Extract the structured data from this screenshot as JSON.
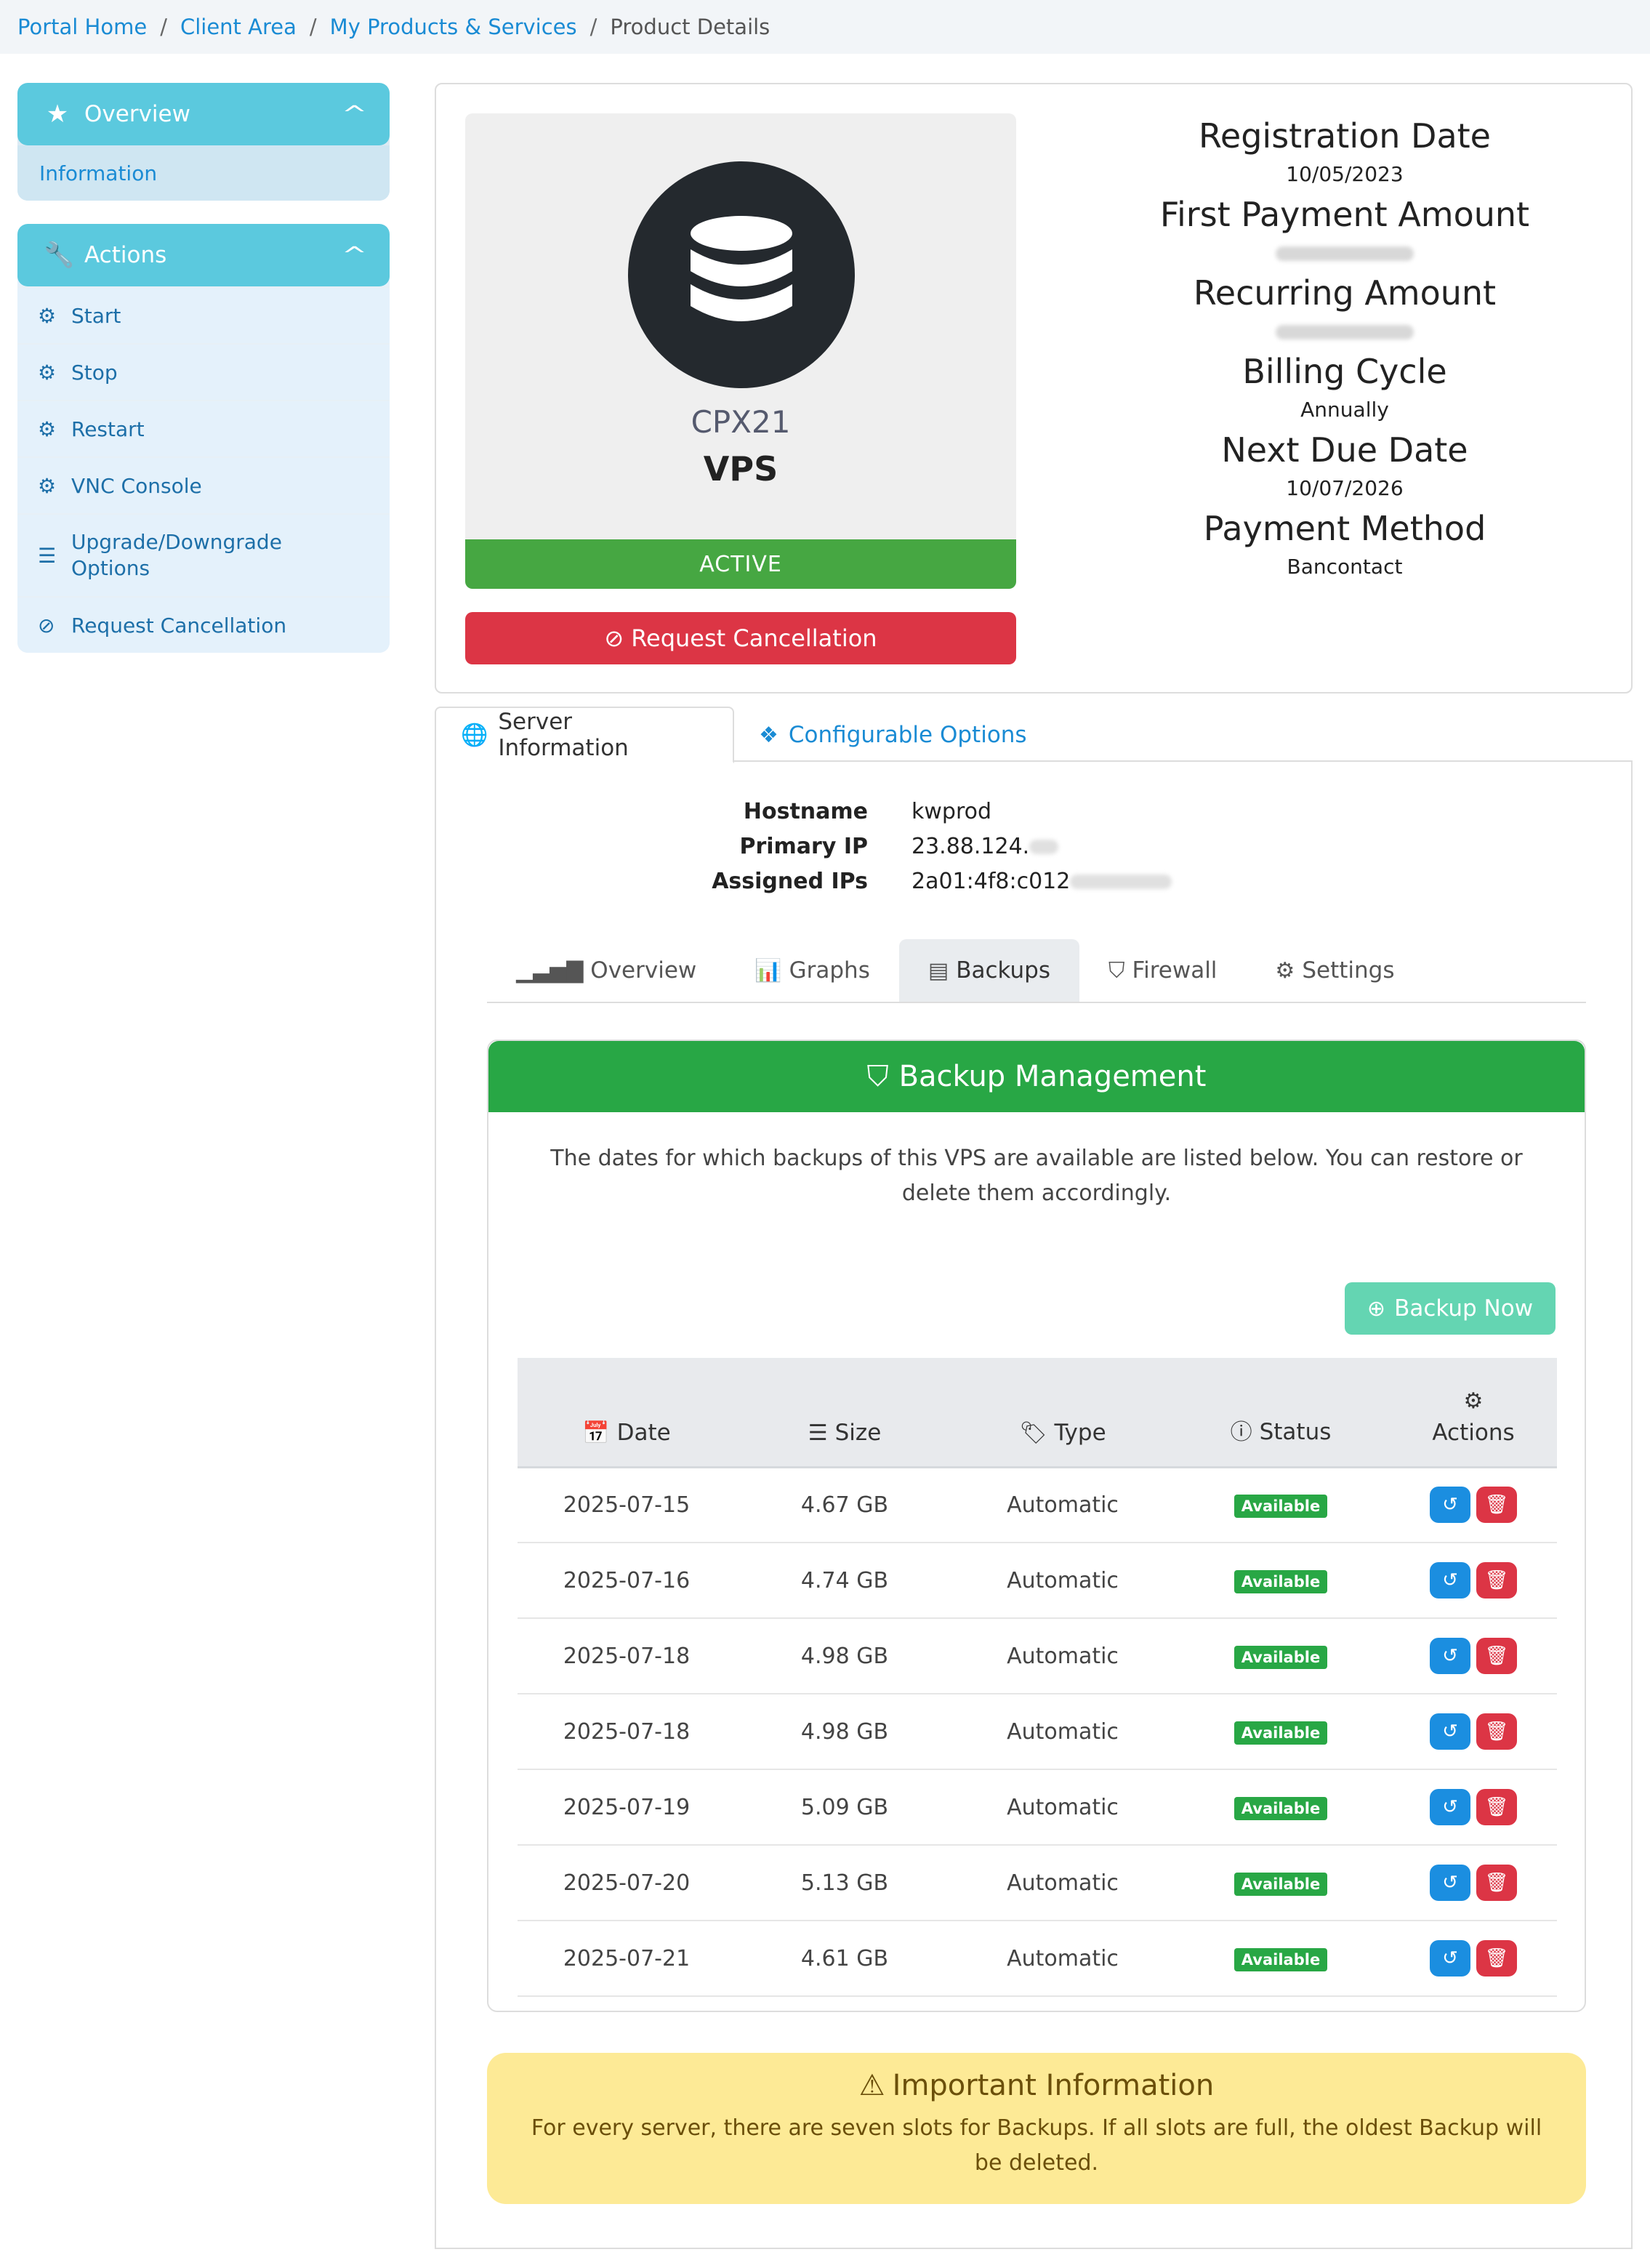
{
  "breadcrumb": {
    "items": [
      "Portal Home",
      "Client Area",
      "My Products & Services"
    ],
    "current": "Product Details"
  },
  "sidebar": {
    "overview": {
      "title": "Overview",
      "items": [
        "Information"
      ]
    },
    "actions": {
      "title": "Actions",
      "items": [
        "Start",
        "Stop",
        "Restart",
        "VNC Console",
        "Upgrade/Downgrade Options",
        "Request Cancellation"
      ]
    }
  },
  "product": {
    "name": "CPX21",
    "group": "VPS",
    "status": "ACTIVE",
    "cancel_label": "Request Cancellation"
  },
  "details": {
    "registration_label": "Registration Date",
    "registration_value": "10/05/2023",
    "first_payment_label": "First Payment Amount",
    "recurring_label": "Recurring Amount",
    "billing_cycle_label": "Billing Cycle",
    "billing_cycle_value": "Annually",
    "next_due_label": "Next Due Date",
    "next_due_value": "10/07/2026",
    "payment_method_label": "Payment Method",
    "payment_method_value": "Bancontact"
  },
  "tabs": {
    "server_info": "Server Information",
    "config_options": "Configurable Options"
  },
  "server": {
    "hostname_label": "Hostname",
    "hostname": "kwprod",
    "primary_ip_label": "Primary IP",
    "primary_ip": "23.88.124.",
    "assigned_ips_label": "Assigned IPs",
    "assigned_ips": "2a01:4f8:c012"
  },
  "subtabs": [
    "Overview",
    "Graphs",
    "Backups",
    "Firewall",
    "Settings"
  ],
  "backups": {
    "title": "Backup Management",
    "description": "The dates for which backups of this VPS are available are listed below. You can restore or delete them accordingly.",
    "backup_now_label": "Backup Now",
    "columns": [
      "Date",
      "Size",
      "Type",
      "Status",
      "Actions"
    ],
    "rows": [
      {
        "date": "2025-07-15",
        "size": "4.67 GB",
        "type": "Automatic",
        "status": "Available"
      },
      {
        "date": "2025-07-16",
        "size": "4.74 GB",
        "type": "Automatic",
        "status": "Available"
      },
      {
        "date": "2025-07-18",
        "size": "4.98 GB",
        "type": "Automatic",
        "status": "Available"
      },
      {
        "date": "2025-07-18",
        "size": "4.98 GB",
        "type": "Automatic",
        "status": "Available"
      },
      {
        "date": "2025-07-19",
        "size": "5.09 GB",
        "type": "Automatic",
        "status": "Available"
      },
      {
        "date": "2025-07-20",
        "size": "5.13 GB",
        "type": "Automatic",
        "status": "Available"
      },
      {
        "date": "2025-07-21",
        "size": "4.61 GB",
        "type": "Automatic",
        "status": "Available"
      }
    ]
  },
  "important": {
    "title": "Important Information",
    "text": "For every server, there are seven slots for Backups. If all slots are full, the oldest Backup will be deleted."
  },
  "colors": {
    "accent": "#1a8bd4",
    "sidebar_head": "#5bc9de",
    "active": "#46a742",
    "danger": "#dc3545",
    "backup_head": "#28a745",
    "warning_bg": "#fdea96"
  }
}
